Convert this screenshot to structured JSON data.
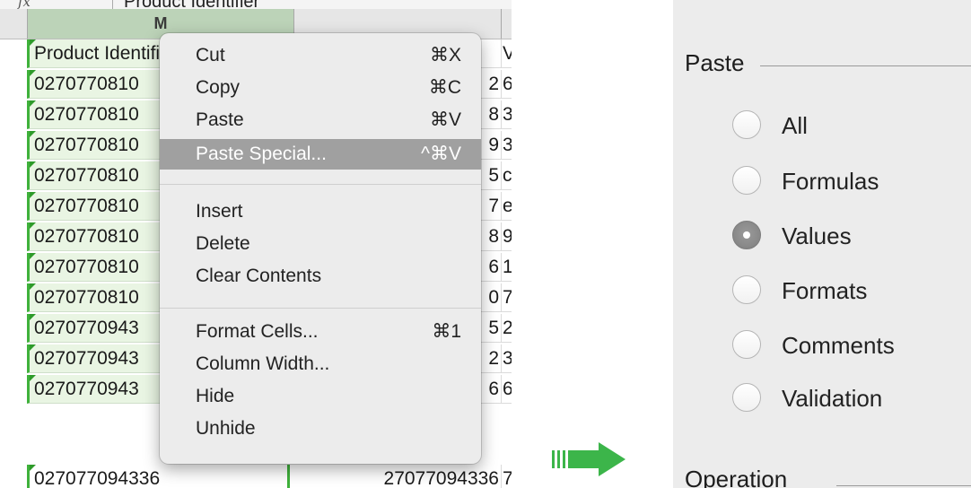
{
  "formula_bar": {
    "fx_label": "fx",
    "text": "Product Identifier"
  },
  "columns": {
    "m_header": "M"
  },
  "rows": [
    {
      "m": "Product Identifier",
      "n": "",
      "o": "V"
    },
    {
      "m": "0270770810",
      "n": "2",
      "o": "6"
    },
    {
      "m": "0270770810",
      "n": "8",
      "o": "3"
    },
    {
      "m": "0270770810",
      "n": "9",
      "o": "3"
    },
    {
      "m": "0270770810",
      "n": "5",
      "o": "c"
    },
    {
      "m": "0270770810",
      "n": "7",
      "o": "e"
    },
    {
      "m": "0270770810",
      "n": "8",
      "o": "9"
    },
    {
      "m": "0270770810",
      "n": "6",
      "o": "1"
    },
    {
      "m": "0270770810",
      "n": "0",
      "o": "7"
    },
    {
      "m": "0270770943",
      "n": "5",
      "o": "2"
    },
    {
      "m": "0270770943",
      "n": "2",
      "o": "3"
    },
    {
      "m": "0270770943",
      "n": "6",
      "o": "6"
    },
    {
      "m": "027077094336",
      "n": "27077094336",
      "o": "7"
    }
  ],
  "context_menu": {
    "items": [
      {
        "label": "Cut",
        "shortcut": "⌘X"
      },
      {
        "label": "Copy",
        "shortcut": "⌘C"
      },
      {
        "label": "Paste",
        "shortcut": "⌘V"
      },
      {
        "label": "Paste Special...",
        "shortcut": "^⌘V"
      },
      {
        "label": "Insert",
        "shortcut": ""
      },
      {
        "label": "Delete",
        "shortcut": ""
      },
      {
        "label": "Clear Contents",
        "shortcut": ""
      },
      {
        "label": "Format Cells...",
        "shortcut": "⌘1"
      },
      {
        "label": "Column Width...",
        "shortcut": ""
      },
      {
        "label": "Hide",
        "shortcut": ""
      },
      {
        "label": "Unhide",
        "shortcut": ""
      }
    ],
    "highlighted": "Paste Special..."
  },
  "dialog": {
    "paste_section_title": "Paste",
    "paste_options": [
      "All",
      "Formulas",
      "Values",
      "Formats",
      "Comments",
      "Validation"
    ],
    "selected_option": "Values",
    "operation_section_title": "Operation"
  },
  "colors": {
    "selection_green": "#3fb13b",
    "arrow_green": "#3cb54a",
    "menu_highlight": "#a0a0a0"
  },
  "icons": {
    "arrow": "right-arrow-icon"
  }
}
